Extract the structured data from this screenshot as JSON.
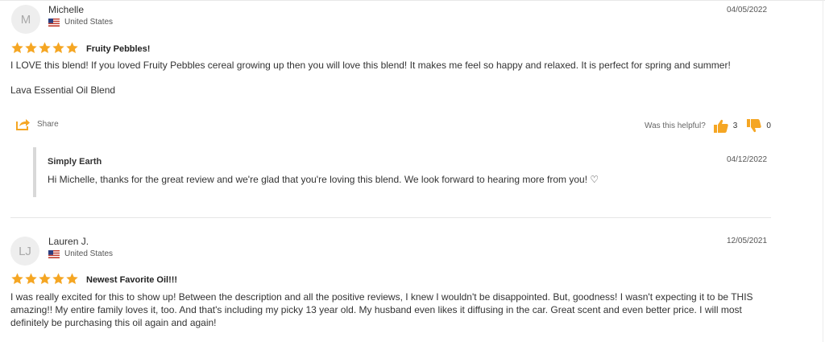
{
  "reviews": [
    {
      "avatar_initials": "M",
      "name": "Michelle",
      "country": "United States",
      "date": "04/05/2022",
      "rating": 5,
      "title": "Fruity Pebbles!",
      "body": "I LOVE this blend! If you loved Fruity Pebbles cereal growing up then you will love this blend! It makes me feel so happy and relaxed. It is perfect for spring and summer!",
      "product": "Lava Essential Oil Blend",
      "share_label": "Share",
      "helpful_label": "Was this helpful?",
      "helpful_yes": "3",
      "helpful_no": "0",
      "reply": {
        "name": "Simply Earth",
        "date": "04/12/2022",
        "text": "Hi Michelle, thanks for the great review and we're glad that you're loving this blend. We look forward to hearing more from you! ♡"
      }
    },
    {
      "avatar_initials": "LJ",
      "name": "Lauren J.",
      "country": "United States",
      "date": "12/05/2021",
      "rating": 5,
      "title": "Newest Favorite Oil!!!",
      "body": "I was really excited for this to show up! Between the description and all the positive reviews, I knew I wouldn't be disappointed. But, goodness! I wasn't expecting it to be THIS amazing!! My entire family loves it, too. And that's including my picky 13 year old. My husband even likes it diffusing in the car. Great scent and even better price. I will most definitely be purchasing this oil again and again!"
    }
  ],
  "colors": {
    "star": "#f5a623",
    "thumb": "#f5a623",
    "share_icon": "#f5a623"
  }
}
